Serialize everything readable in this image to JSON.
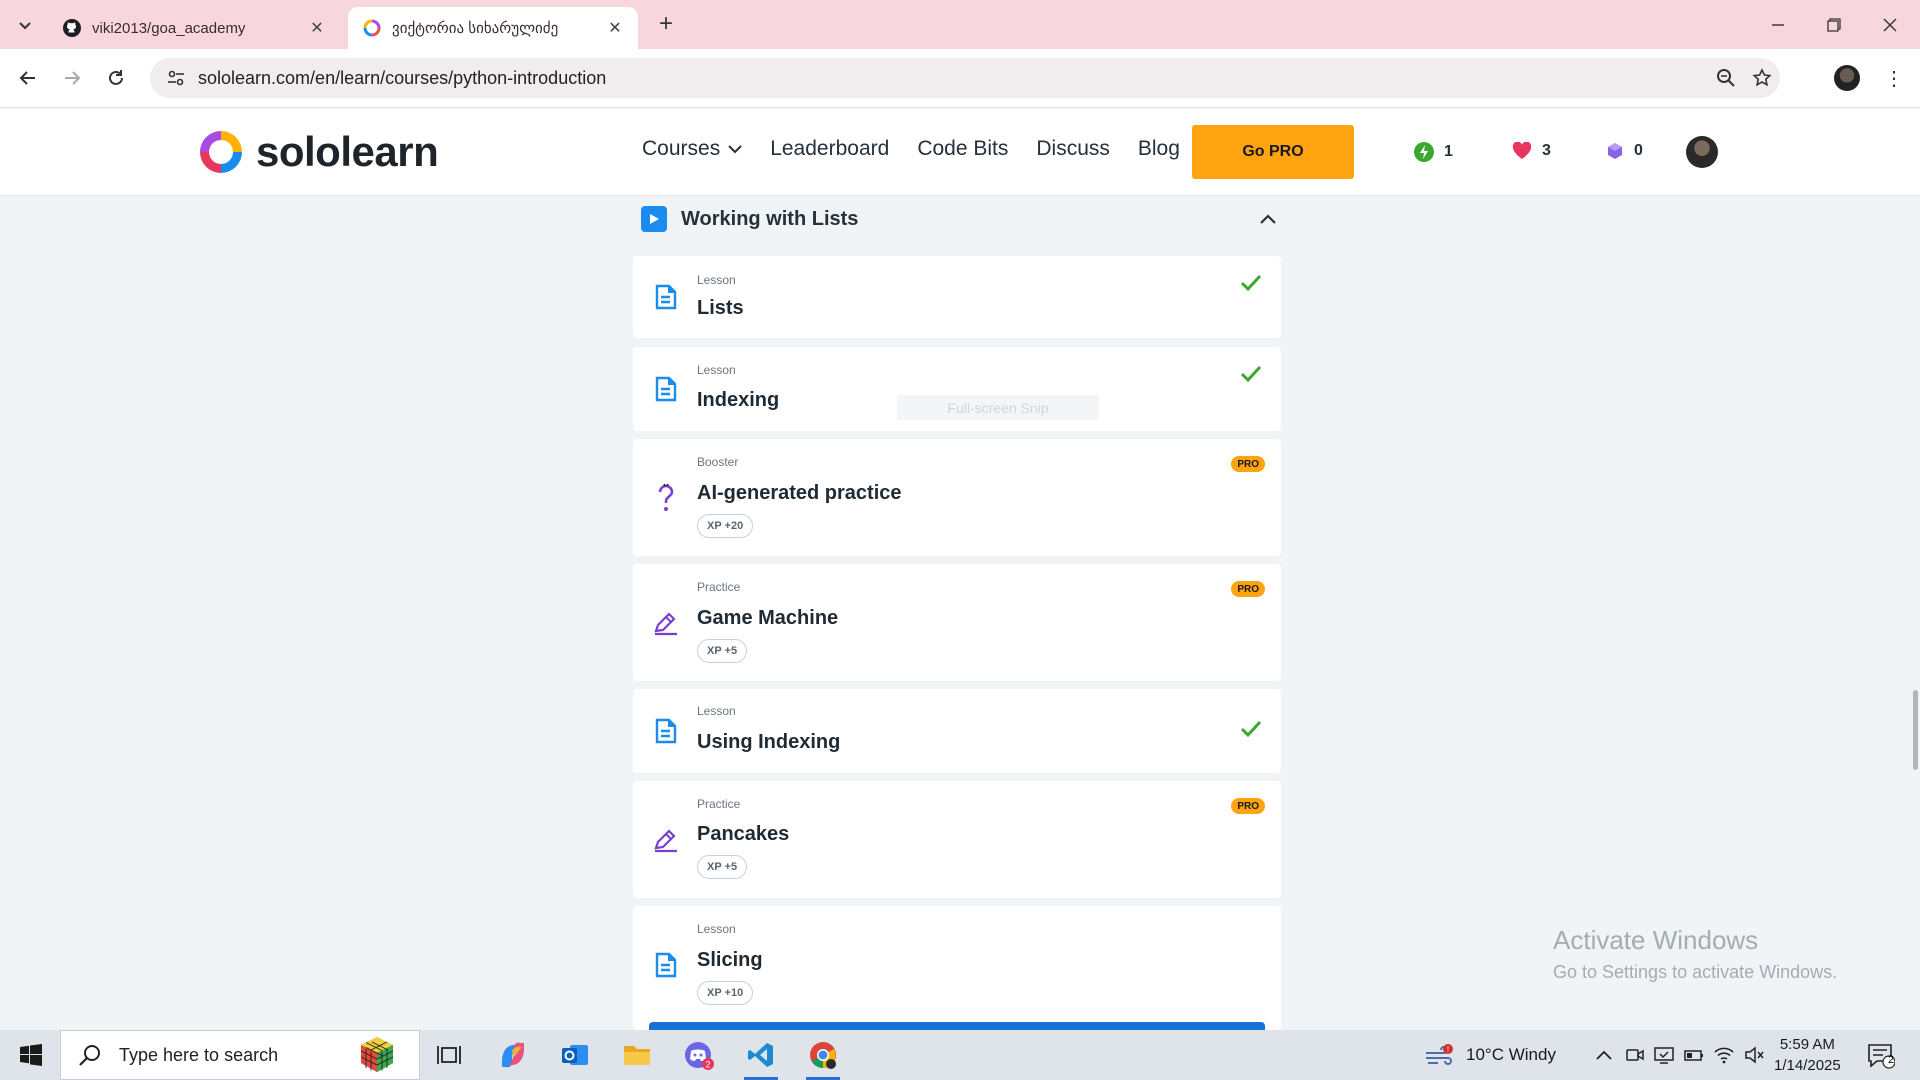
{
  "browser": {
    "tabs": [
      {
        "title": "viki2013/goa_academy",
        "favicon": "github-icon"
      },
      {
        "title": "ვიქტორია სიხარულიძე",
        "favicon": "sololearn-icon"
      }
    ],
    "url": "sololearn.com/en/learn/courses/python-introduction"
  },
  "header": {
    "logo_text": "sololearn",
    "nav": [
      "Courses",
      "Leaderboard",
      "Code Bits",
      "Discuss",
      "Blog"
    ],
    "gopro_label": "Go PRO",
    "streak": "1",
    "hearts": "3",
    "gems": "0"
  },
  "module": {
    "title": "Working with Lists"
  },
  "items": [
    {
      "kind": "Lesson",
      "name": "Lists",
      "completed": true,
      "pro": false,
      "icon": "lesson-icon"
    },
    {
      "kind": "Lesson",
      "name": "Indexing",
      "completed": true,
      "pro": false,
      "icon": "lesson-icon"
    },
    {
      "kind": "Booster",
      "name": "AI-generated practice",
      "xp": "XP +20",
      "pro": true,
      "pro_label": "PRO",
      "icon": "ai-practice-icon"
    },
    {
      "kind": "Practice",
      "name": "Game Machine",
      "xp": "XP +5",
      "pro": true,
      "pro_label": "PRO",
      "icon": "practice-icon"
    },
    {
      "kind": "Lesson",
      "name": "Using Indexing",
      "completed": true,
      "pro": false,
      "icon": "lesson-icon"
    },
    {
      "kind": "Practice",
      "name": "Pancakes",
      "xp": "XP +5",
      "pro": true,
      "pro_label": "PRO",
      "icon": "practice-icon"
    },
    {
      "kind": "Lesson",
      "name": "Slicing",
      "xp": "XP +10",
      "pro": false,
      "icon": "lesson-icon"
    }
  ],
  "overlay": {
    "snip_text": "Full-screen Snip",
    "activate_line1": "Activate Windows",
    "activate_line2": "Go to Settings to activate Windows."
  },
  "taskbar": {
    "search_placeholder": "Type here to search",
    "weather": "10°C  Windy",
    "time": "5:59 AM",
    "date": "1/14/2025",
    "notification_count": "2"
  },
  "colors": {
    "accent": "#ffa310",
    "check": "#3aa82e",
    "lesson_icon": "#1a8cf0",
    "practice_icon": "#7a3fd1"
  }
}
